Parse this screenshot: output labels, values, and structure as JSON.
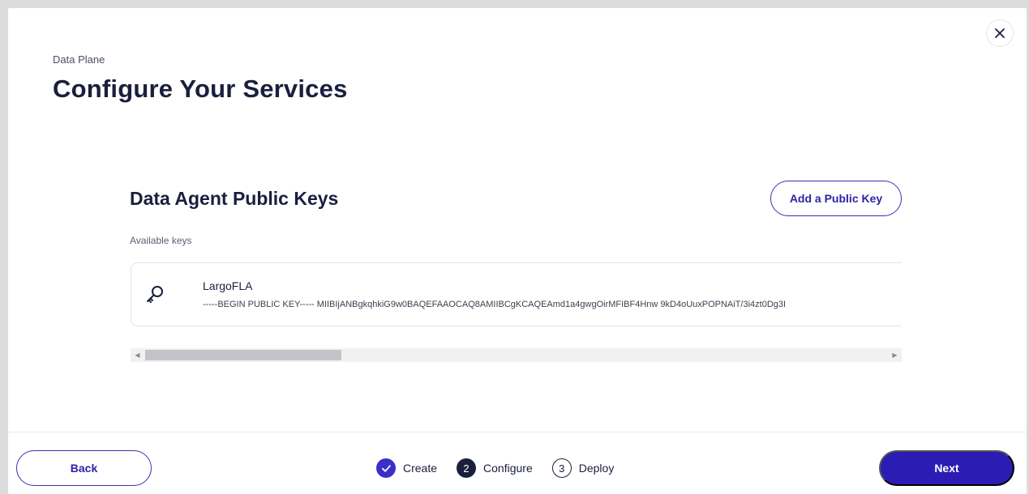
{
  "header": {
    "eyebrow": "Data Plane",
    "title": "Configure Your Services"
  },
  "section": {
    "title": "Data Agent Public Keys",
    "add_button": "Add a Public Key",
    "available_label": "Available keys"
  },
  "keys": [
    {
      "name": "LargoFLA",
      "value": "-----BEGIN PUBLIC KEY----- MIIBIjANBgkqhkiG9w0BAQEFAAOCAQ8AMIIBCgKCAQEAmd1a4gwgOirMFIBF4Hnw 9kD4oUuxPOPNAiT/3i4zt0Dg3I",
      "icon": "key-icon"
    }
  ],
  "stepper": {
    "steps": [
      {
        "number": "",
        "label": "Create",
        "state": "done"
      },
      {
        "number": "2",
        "label": "Configure",
        "state": "active"
      },
      {
        "number": "3",
        "label": "Deploy",
        "state": "pending"
      }
    ]
  },
  "footer": {
    "back_label": "Back",
    "next_label": "Next"
  },
  "colors": {
    "primary": "#2b1cb3",
    "text": "#1a1f3d",
    "step_done": "#3b2fc9"
  }
}
